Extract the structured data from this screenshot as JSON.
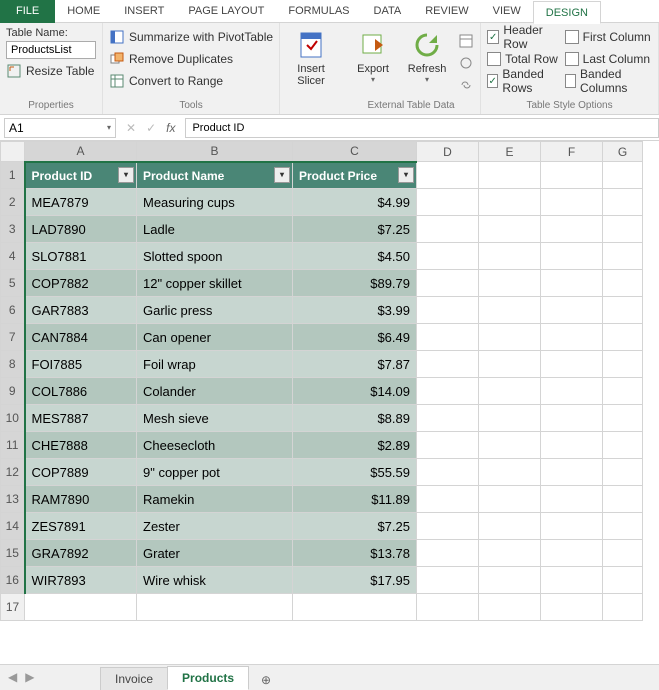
{
  "tabs": {
    "file": "FILE",
    "home": "HOME",
    "insert": "INSERT",
    "page_layout": "PAGE LAYOUT",
    "formulas": "FORMULAS",
    "data": "DATA",
    "review": "REVIEW",
    "view": "VIEW",
    "design": "DESIGN"
  },
  "ribbon": {
    "table_name_label": "Table Name:",
    "table_name_value": "ProductsList",
    "resize_table": "Resize Table",
    "properties_label": "Properties",
    "summarize": "Summarize with PivotTable",
    "remove_dup": "Remove Duplicates",
    "convert_range": "Convert to Range",
    "tools_label": "Tools",
    "insert_slicer": "Insert\nSlicer",
    "export": "Export",
    "refresh": "Refresh",
    "ext_label": "External Table Data",
    "header_row": "Header Row",
    "total_row": "Total Row",
    "banded_rows": "Banded Rows",
    "first_col": "First Column",
    "last_col": "Last Column",
    "banded_cols": "Banded Columns",
    "style_label": "Table Style Options"
  },
  "namebox": "A1",
  "formula_value": "Product ID",
  "columns": [
    "A",
    "B",
    "C",
    "D",
    "E",
    "F",
    "G"
  ],
  "headers": {
    "id": "Product ID",
    "name": "Product Name",
    "price": "Product Price"
  },
  "rows": [
    {
      "n": "2",
      "id": "MEA7879",
      "name": "Measuring cups",
      "price": "$4.99"
    },
    {
      "n": "3",
      "id": "LAD7890",
      "name": "Ladle",
      "price": "$7.25"
    },
    {
      "n": "4",
      "id": "SLO7881",
      "name": "Slotted spoon",
      "price": "$4.50"
    },
    {
      "n": "5",
      "id": "COP7882",
      "name": "12\" copper skillet",
      "price": "$89.79"
    },
    {
      "n": "6",
      "id": "GAR7883",
      "name": "Garlic press",
      "price": "$3.99"
    },
    {
      "n": "7",
      "id": "CAN7884",
      "name": "Can opener",
      "price": "$6.49"
    },
    {
      "n": "8",
      "id": "FOI7885",
      "name": "Foil wrap",
      "price": "$7.87"
    },
    {
      "n": "9",
      "id": "COL7886",
      "name": "Colander",
      "price": "$14.09"
    },
    {
      "n": "10",
      "id": "MES7887",
      "name": "Mesh sieve",
      "price": "$8.89"
    },
    {
      "n": "11",
      "id": "CHE7888",
      "name": "Cheesecloth",
      "price": "$2.89"
    },
    {
      "n": "12",
      "id": "COP7889",
      "name": "9\" copper pot",
      "price": "$55.59"
    },
    {
      "n": "13",
      "id": "RAM7890",
      "name": "Ramekin",
      "price": "$11.89"
    },
    {
      "n": "14",
      "id": "ZES7891",
      "name": "Zester",
      "price": "$7.25"
    },
    {
      "n": "15",
      "id": "GRA7892",
      "name": "Grater",
      "price": "$13.78"
    },
    {
      "n": "16",
      "id": "WIR7893",
      "name": "Wire whisk",
      "price": "$17.95"
    }
  ],
  "empty_row": "17",
  "sheets": {
    "invoice": "Invoice",
    "products": "Products"
  }
}
